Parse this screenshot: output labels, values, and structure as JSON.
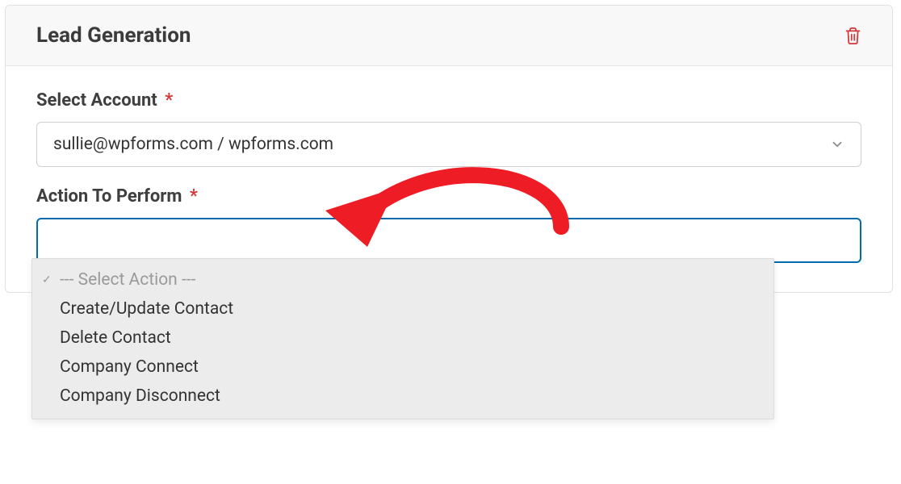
{
  "header": {
    "title": "Lead Generation"
  },
  "fields": {
    "select_account": {
      "label": "Select Account",
      "required_mark": "*",
      "value": "sullie@wpforms.com / wpforms.com"
    },
    "action_to_perform": {
      "label": "Action To Perform",
      "required_mark": "*",
      "placeholder": "--- Select Action ---",
      "options": [
        "Create/Update Contact",
        "Delete Contact",
        "Company Connect",
        "Company Disconnect"
      ]
    }
  },
  "colors": {
    "danger": "#d63638",
    "accent": "#036aab",
    "annotation": "#ee1c25"
  }
}
